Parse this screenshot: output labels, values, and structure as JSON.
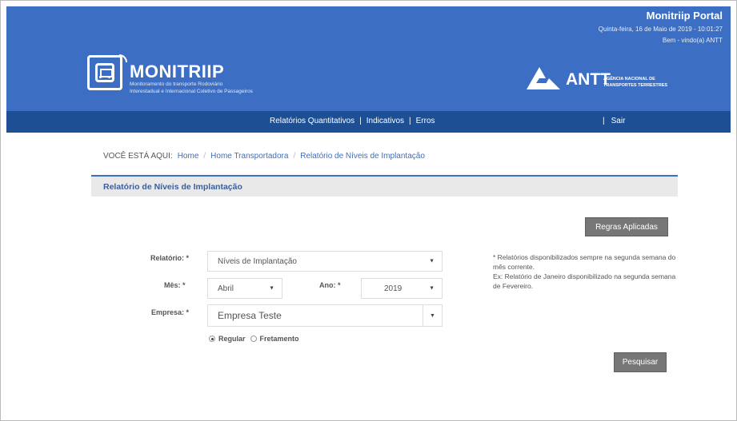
{
  "header": {
    "portal_title": "Monitriip Portal",
    "date_time": "Quinta-feira, 16 de Maio de 2019 - 10:01:27",
    "welcome": "Bem - vindo(a) ANTT",
    "brand_name": "MONITRIIP",
    "brand_sub1": "Monitoramento do transporte Rodoviário",
    "brand_sub2": "Interestadual e Internacional Coletivo de Passageiros",
    "antt_name": "ANTT",
    "antt_sub1": "AGÊNCIA NACIONAL DE",
    "antt_sub2": "TRANSPORTES TERRESTRES"
  },
  "nav": {
    "items": [
      "Relatórios Quantitativos",
      "Indicativos",
      "Erros"
    ],
    "separator": "|",
    "logout": "Sair"
  },
  "breadcrumb": {
    "prefix": "VOCÊ ESTÁ AQUI:",
    "items": [
      "Home",
      "Home Transportadora",
      "Relatório de Níveis de Implantação"
    ],
    "separator": "/"
  },
  "section": {
    "title": "Relatório de Níveis de Implantação"
  },
  "buttons": {
    "regras": "Regras Aplicadas",
    "pesquisar": "Pesquisar"
  },
  "form": {
    "relatorio_label": "Relatório: *",
    "relatorio_value": "Níveis de Implantação",
    "mes_label": "Mês: *",
    "mes_value": "Abril",
    "ano_label": "Ano: *",
    "ano_value": "2019",
    "empresa_label": "Empresa: *",
    "empresa_value": "Empresa Teste",
    "radio_regular": "Regular",
    "radio_fretamento": "Fretamento"
  },
  "notes": {
    "line1": "* Relatórios disponibilizados sempre na segunda semana do mês corrente.",
    "line2": "Ex: Relatório de Janeiro disponibilizado na segunda semana de Fevereiro."
  },
  "colors": {
    "header_bg": "#3c6fc3",
    "nav_bg": "#1d4f95",
    "button_bg": "#777777"
  }
}
